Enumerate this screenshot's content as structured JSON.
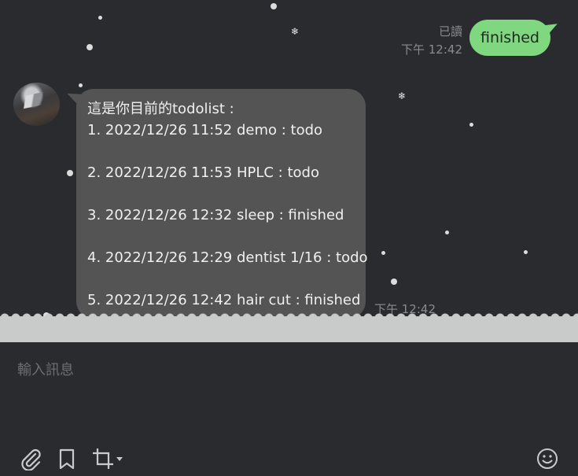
{
  "outgoing": {
    "text": "finished",
    "read": "已讀",
    "time": "下午 12:42",
    "bubble_color": "#7fd77f"
  },
  "incoming": {
    "intro": "這是你目前的todolist :",
    "items": [
      "1. 2022/12/26 11:52 demo : todo",
      "2. 2022/12/26 11:53 HPLC : todo",
      "3. 2022/12/26 12:32 sleep : finished",
      "4. 2022/12/26 12:29 dentist 1/16 : todo",
      "5. 2022/12/26 12:42 hair cut : finished"
    ],
    "time": "下午 12:42",
    "bubble_color": "#545454"
  },
  "composer": {
    "placeholder": "輸入訊息"
  },
  "toolbar": {
    "icons": [
      "paperclip-icon",
      "bookmark-icon",
      "crop-icon",
      "emoji-icon"
    ]
  }
}
